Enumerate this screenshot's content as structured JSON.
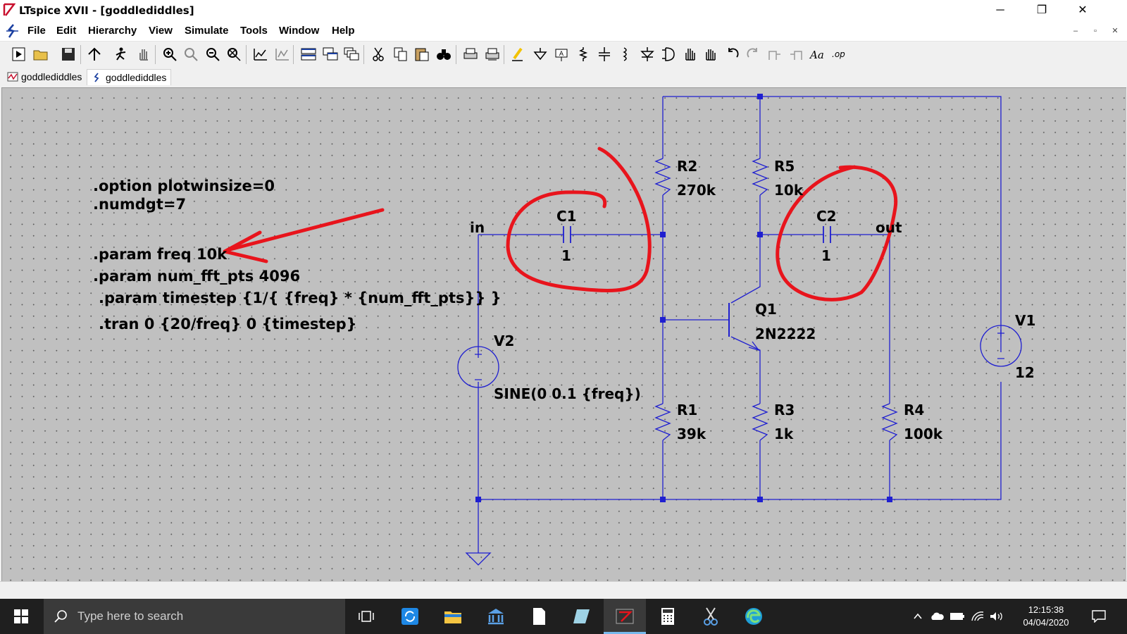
{
  "window": {
    "title": "LTspice XVII - [goddlediddles]",
    "minimize_glyph": "─",
    "maximize_glyph": "❐",
    "close_glyph": "✕"
  },
  "menu": {
    "items": [
      "File",
      "Edit",
      "Hierarchy",
      "View",
      "Simulate",
      "Tools",
      "Window",
      "Help"
    ]
  },
  "tabs": [
    {
      "label": "goddlediddles",
      "icon": "waveform-viewer-icon"
    },
    {
      "label": "goddlediddles",
      "icon": "schematic-icon"
    }
  ],
  "schematic": {
    "directives": [
      ".option plotwinsize=0",
      ".numdgt=7",
      ".param freq 10k",
      ".param num_fft_pts 4096",
      ".param timestep {1/{ {freq} * {num_fft_pts}} }",
      ".tran 0 {20/freq} 0 {timestep}"
    ],
    "net_labels": {
      "in": "in",
      "out": "out"
    },
    "components": {
      "R2": {
        "name": "R2",
        "value": "270k"
      },
      "R5": {
        "name": "R5",
        "value": "10k"
      },
      "C1": {
        "name": "C1",
        "value": "1"
      },
      "C2": {
        "name": "C2",
        "value": "1"
      },
      "Q1": {
        "name": "Q1",
        "value": "2N2222"
      },
      "V1": {
        "name": "V1",
        "value": "12"
      },
      "V2": {
        "name": "V2",
        "value": "SINE(0 0.1 {freq})"
      },
      "R1": {
        "name": "R1",
        "value": "39k"
      },
      "R3": {
        "name": "R3",
        "value": "1k"
      },
      "R4": {
        "name": "R4",
        "value": "100k"
      }
    },
    "colors": {
      "wire": "#1f1fd0",
      "node": "#1f1fd0",
      "annotation": "#e8141c",
      "text": "#000000",
      "background": "#c0c0c0"
    }
  },
  "taskbar": {
    "search_placeholder": "Type here to search",
    "time": "12:15:38",
    "date": "04/04/2020"
  }
}
